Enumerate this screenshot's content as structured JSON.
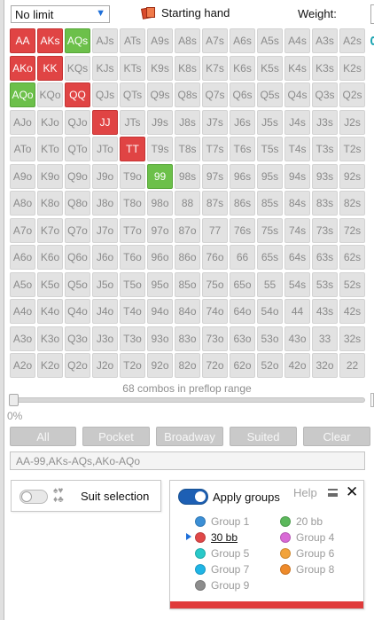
{
  "topbar": {
    "limit_value": "No limit",
    "starting_hand_label": "Starting hand",
    "weight_label": "Weight:"
  },
  "grid": [
    [
      "AA",
      "AKs",
      "AQs",
      "AJs",
      "ATs",
      "A9s",
      "A8s",
      "A7s",
      "A6s",
      "A5s",
      "A4s",
      "A3s",
      "A2s"
    ],
    [
      "AKo",
      "KK",
      "KQs",
      "KJs",
      "KTs",
      "K9s",
      "K8s",
      "K7s",
      "K6s",
      "K5s",
      "K4s",
      "K3s",
      "K2s"
    ],
    [
      "AQo",
      "KQo",
      "QQ",
      "QJs",
      "QTs",
      "Q9s",
      "Q8s",
      "Q7s",
      "Q6s",
      "Q5s",
      "Q4s",
      "Q3s",
      "Q2s"
    ],
    [
      "AJo",
      "KJo",
      "QJo",
      "JJ",
      "JTs",
      "J9s",
      "J8s",
      "J7s",
      "J6s",
      "J5s",
      "J4s",
      "J3s",
      "J2s"
    ],
    [
      "ATo",
      "KTo",
      "QTo",
      "JTo",
      "TT",
      "T9s",
      "T8s",
      "T7s",
      "T6s",
      "T5s",
      "T4s",
      "T3s",
      "T2s"
    ],
    [
      "A9o",
      "K9o",
      "Q9o",
      "J9o",
      "T9o",
      "99",
      "98s",
      "97s",
      "96s",
      "95s",
      "94s",
      "93s",
      "92s"
    ],
    [
      "A8o",
      "K8o",
      "Q8o",
      "J8o",
      "T8o",
      "98o",
      "88",
      "87s",
      "86s",
      "85s",
      "84s",
      "83s",
      "82s"
    ],
    [
      "A7o",
      "K7o",
      "Q7o",
      "J7o",
      "T7o",
      "97o",
      "87o",
      "77",
      "76s",
      "75s",
      "74s",
      "73s",
      "72s"
    ],
    [
      "A6o",
      "K6o",
      "Q6o",
      "J6o",
      "T6o",
      "96o",
      "86o",
      "76o",
      "66",
      "65s",
      "64s",
      "63s",
      "62s"
    ],
    [
      "A5o",
      "K5o",
      "Q5o",
      "J5o",
      "T5o",
      "95o",
      "85o",
      "75o",
      "65o",
      "55",
      "54s",
      "53s",
      "52s"
    ],
    [
      "A4o",
      "K4o",
      "Q4o",
      "J4o",
      "T4o",
      "94o",
      "84o",
      "74o",
      "64o",
      "54o",
      "44",
      "43s",
      "42s"
    ],
    [
      "A3o",
      "K3o",
      "Q3o",
      "J3o",
      "T3o",
      "93o",
      "83o",
      "73o",
      "63o",
      "53o",
      "43o",
      "33",
      "32s"
    ],
    [
      "A2o",
      "K2o",
      "Q2o",
      "J2o",
      "T2o",
      "92o",
      "82o",
      "72o",
      "62o",
      "52o",
      "42o",
      "32o",
      "22"
    ]
  ],
  "highlight": {
    "red": [
      "AA",
      "AKs",
      "AKo",
      "KK",
      "QQ",
      "JJ",
      "TT"
    ],
    "green": [
      "AQs",
      "AQo",
      "99"
    ]
  },
  "colors": {
    "red": "#e04444",
    "green": "#6cc04a",
    "accent": "#1e6fd9"
  },
  "combos_text": "68 combos in preflop range",
  "slider": {
    "percent_label": "0%",
    "value_percent": 0
  },
  "buttons": [
    "All",
    "Pocket",
    "Broadway",
    "Suited",
    "Clear"
  ],
  "range_text": "AA-99,AKs-AQs,AKo-AQo",
  "suit_selection": {
    "label": "Suit selection",
    "enabled": false
  },
  "groups": {
    "apply_label": "Apply groups",
    "help_label": "Help",
    "enabled": true,
    "items": [
      {
        "label": "Group 1",
        "color": "#3b8fd6"
      },
      {
        "label": "20 bb",
        "color": "#5cb85c"
      },
      {
        "label": "30 bb",
        "color": "#e04848",
        "active": true
      },
      {
        "label": "Group 4",
        "color": "#d96ad6"
      },
      {
        "label": "Group 5",
        "color": "#29c9c9"
      },
      {
        "label": "Group 6",
        "color": "#f2a33a"
      },
      {
        "label": "Group 7",
        "color": "#1fb5e6"
      },
      {
        "label": "Group 8",
        "color": "#ee8a2a"
      },
      {
        "label": "Group 9",
        "color": "#8d8d8d"
      }
    ]
  }
}
